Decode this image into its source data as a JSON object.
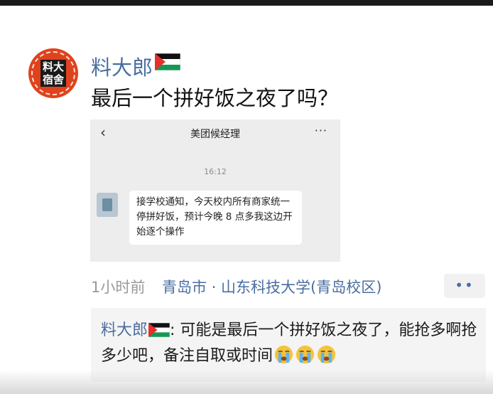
{
  "post": {
    "username": "料大郎",
    "avatar_text": "料大宿舍",
    "content": "最后一个拼好饭之夜了吗？",
    "flag_icon": "palestine-flag-icon"
  },
  "screenshot": {
    "chat_title": "美团候经理",
    "time": "16:12",
    "message": "接学校通知，今天校内所有商家统一停拼好饭，预计今晚 8 点多我这边开始逐个操作"
  },
  "meta": {
    "time_ago": "1小时前",
    "location": "青岛市 · 山东科技大学(青岛校区)",
    "more_label": "••"
  },
  "comment": {
    "name": "料大郎",
    "separator": ":",
    "text": " 可能是最后一个拼好饭之夜了，能抢多啊抢多少吧，备注自取或时间",
    "emoji_icon": "loudly-crying-face-icon"
  },
  "colors": {
    "link": "#4a6ea0",
    "avatar_bg": "#e0421d",
    "flag_red": "#e4312b",
    "flag_green": "#149954"
  }
}
